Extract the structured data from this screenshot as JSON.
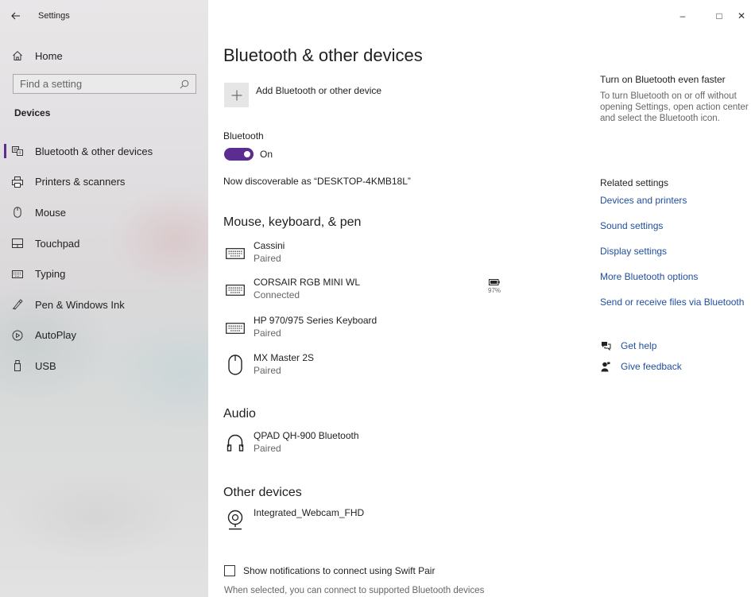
{
  "window": {
    "title": "Settings",
    "back_icon": "back-arrow-icon",
    "controls": {
      "minimize": "–",
      "maximize": "□",
      "close": "✕"
    }
  },
  "sidebar": {
    "home_label": "Home",
    "search_placeholder": "Find a setting",
    "section_title": "Devices",
    "items": [
      {
        "label": "Bluetooth & other devices",
        "icon": "bluetooth-devices-icon",
        "selected": true
      },
      {
        "label": "Printers & scanners",
        "icon": "printer-icon"
      },
      {
        "label": "Mouse",
        "icon": "mouse-icon"
      },
      {
        "label": "Touchpad",
        "icon": "touchpad-icon"
      },
      {
        "label": "Typing",
        "icon": "keyboard-icon"
      },
      {
        "label": "Pen & Windows Ink",
        "icon": "pen-icon"
      },
      {
        "label": "AutoPlay",
        "icon": "autoplay-icon"
      },
      {
        "label": "USB",
        "icon": "usb-icon"
      }
    ]
  },
  "main": {
    "title": "Bluetooth & other devices",
    "add_device_label": "Add Bluetooth or other device",
    "bluetooth_label": "Bluetooth",
    "bluetooth_state": "On",
    "discoverable_text": "Now discoverable as “DESKTOP-4KMB18L”",
    "groups": {
      "input_title": "Mouse, keyboard, & pen",
      "audio_title": "Audio",
      "other_title": "Other devices"
    },
    "devices": {
      "cassini": {
        "name": "Cassini",
        "status": "Paired",
        "icon": "keyboard-icon"
      },
      "corsair": {
        "name": "CORSAIR RGB MINI WL",
        "status": "Connected",
        "icon": "keyboard-icon",
        "battery": "97%"
      },
      "hp": {
        "name": "HP 970/975 Series Keyboard",
        "status": "Paired",
        "icon": "keyboard-icon"
      },
      "mx": {
        "name": "MX Master 2S",
        "status": "Paired",
        "icon": "mouse-icon"
      },
      "qpad": {
        "name": "QPAD QH-900 Bluetooth",
        "status": "Paired",
        "icon": "headphones-icon"
      },
      "webcam": {
        "name": "Integrated_Webcam_FHD",
        "icon": "webcam-icon"
      }
    },
    "swift_pair_label": "Show notifications to connect using Swift Pair",
    "swift_pair_desc": "When selected, you can connect to supported Bluetooth devices"
  },
  "right": {
    "faster_heading": "Turn on Bluetooth even faster",
    "faster_desc": "To turn Bluetooth on or off without opening Settings, open action center and select the Bluetooth icon.",
    "related_heading": "Related settings",
    "links": {
      "devices_printers": "Devices and printers",
      "sound": "Sound settings",
      "display": "Display settings",
      "more_bt": "More Bluetooth options",
      "send_receive": "Send or receive files via Bluetooth"
    },
    "get_help": "Get help",
    "give_feedback": "Give feedback"
  },
  "colors": {
    "accent": "#5c2d91",
    "link": "#1f4e9e"
  }
}
